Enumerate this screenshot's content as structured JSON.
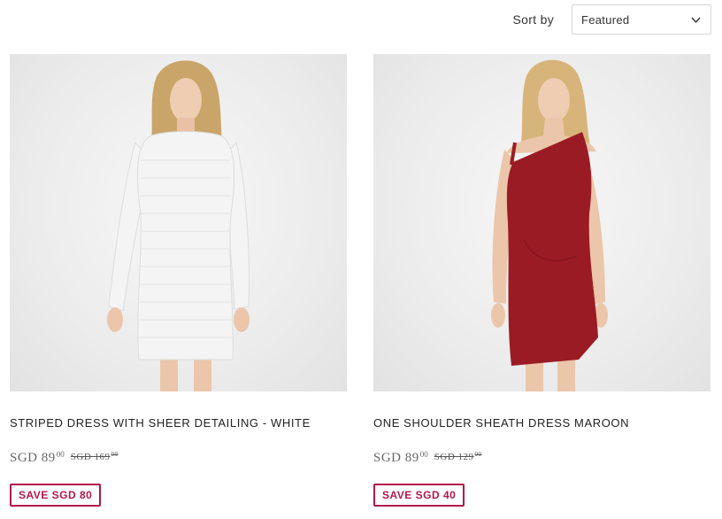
{
  "toolbar": {
    "sort_label": "Sort by",
    "sort_value": "Featured"
  },
  "products": [
    {
      "title": "STRIPED DRESS WITH SHEER DETAILING - WHITE",
      "price_main": "SGD 89",
      "price_cents": "00",
      "compare_main": "SGD 169",
      "compare_cents": "00",
      "badge": "SAVE SGD 80",
      "dress_color": "#f4f4f4"
    },
    {
      "title": "ONE SHOULDER SHEATH DRESS MAROON",
      "price_main": "SGD 89",
      "price_cents": "00",
      "compare_main": "SGD 129",
      "compare_cents": "00",
      "badge": "SAVE SGD 40",
      "dress_color": "#9b1b24"
    }
  ],
  "colors": {
    "badge": "#b3164a",
    "text": "#222222",
    "price": "#666666"
  }
}
